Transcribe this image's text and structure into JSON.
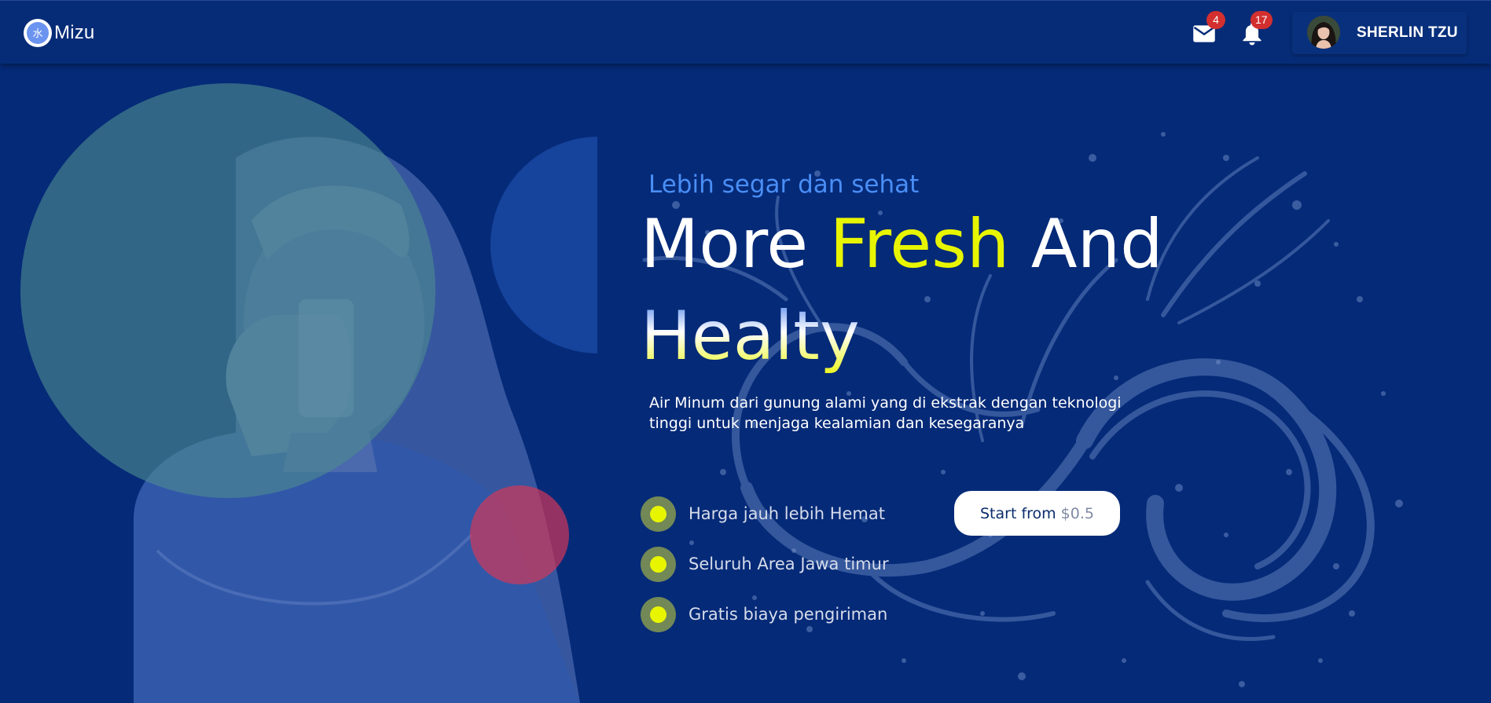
{
  "app": {
    "name": "Mizu",
    "logo_icon": "water-drop-icon"
  },
  "header": {
    "mail": {
      "icon": "mail-icon",
      "count": "4"
    },
    "notifications": {
      "icon": "bell-icon",
      "count": "17"
    },
    "user": {
      "name": "SHERLIN TZU",
      "avatar": "user-avatar"
    }
  },
  "hero": {
    "tagline": "Lebih segar dan sehat",
    "headline_more": "More ",
    "headline_fresh": "Fresh",
    "headline_and": " And",
    "headline_healty": "Healty",
    "description": "Air Minum dari gunung alami yang di ekstrak dengan teknologi tinggi untuk menjaga kealamian dan kesegaranya",
    "features": [
      "Harga jauh lebih Hemat",
      "Seluruh Area Jawa timur",
      "Gratis biaya pengiriman"
    ],
    "cta": {
      "label": "Start from",
      "price": "$0.5"
    }
  },
  "colors": {
    "background": "#052a78",
    "accent_yellow": "#e8f500",
    "tagline_blue": "#4a8ef5",
    "badge_red": "#d32f2f"
  }
}
